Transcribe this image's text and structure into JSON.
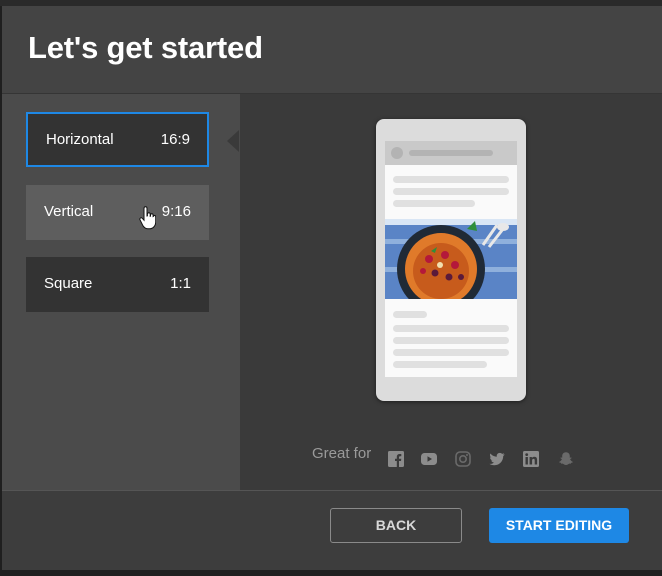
{
  "header": {
    "title": "Let's get started"
  },
  "options": [
    {
      "label": "Horizontal",
      "ratio": "16:9",
      "selected": true
    },
    {
      "label": "Vertical",
      "ratio": "9:16",
      "selected": false
    },
    {
      "label": "Square",
      "ratio": "1:1",
      "selected": false
    }
  ],
  "preview": {
    "great_for_label": "Great for",
    "platforms": [
      "facebook-icon",
      "youtube-icon",
      "instagram-icon",
      "twitter-icon",
      "linkedin-icon",
      "snapchat-icon"
    ]
  },
  "footer": {
    "back_label": "BACK",
    "start_label": "START EDITING"
  },
  "colors": {
    "accent": "#1e88e5",
    "background": "#3d3d3d"
  }
}
